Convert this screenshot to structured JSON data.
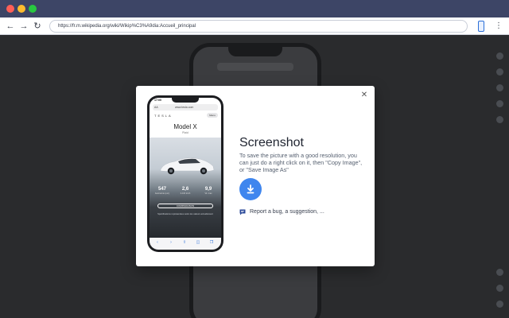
{
  "browser": {
    "url": "https://fr.m.wikipedia.org/wiki/Wikip%C3%A9dia:Accueil_principal"
  },
  "modal": {
    "title": "Screenshot",
    "description": "To save the picture with a good resolution, you can just do a right click on it, then \"Copy Image\", or \"Save Image As\"",
    "report_label": "Report a bug, a suggestion, ...",
    "close_icon": "close-icon",
    "download_icon": "download-icon"
  },
  "preview": {
    "time": "17:00",
    "aa": "AA",
    "url": "www.tesla.com",
    "brand": "TESLA",
    "menu": "Menu",
    "model": "Model X",
    "submodel": "Plaid",
    "stats": [
      {
        "value": "547",
        "label": "Autonomie (est.)"
      },
      {
        "value": "2,6",
        "label": "0-100 km/h"
      },
      {
        "value": "9,9",
        "label": "Vit. max"
      }
    ],
    "compare": "COMPARAISON",
    "specs": "Spécifications représentées selon les valeurs actuellement"
  },
  "colors": {
    "accent": "#3f86ee",
    "chrome": "#3d4566"
  }
}
